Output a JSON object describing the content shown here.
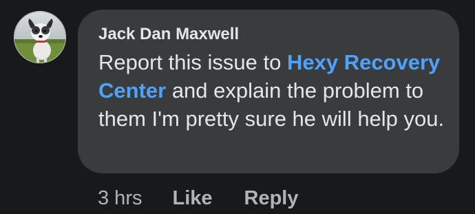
{
  "comment": {
    "author": "Jack Dan Maxwell",
    "avatar_icon": "dog-profile-photo",
    "text_before": "Report this issue to ",
    "mention": "Hexy Recovery Center",
    "text_after": " and explain the problem to them I'm pretty sure he will help you.",
    "timestamp": "3 hrs",
    "like_label": "Like",
    "reply_label": "Reply"
  },
  "colors": {
    "background": "#18191a",
    "bubble": "#3a3b3c",
    "text": "#e4e6eb",
    "secondary_text": "#b0b3b8",
    "mention": "#4da3ff"
  }
}
